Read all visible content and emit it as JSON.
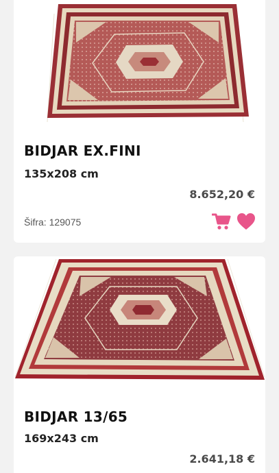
{
  "colors": {
    "accent": "#e8558a",
    "background": "#f2f2f2",
    "card": "#ffffff",
    "title": "#111111",
    "price": "#4a4a4a"
  },
  "products": [
    {
      "title": "BIDJAR EX.FINI",
      "size": "135x208 cm",
      "price": "8.652,20 €",
      "sku_label": "Šifra: 129075",
      "cart_icon": "shopping-cart-icon",
      "wishlist_icon": "heart-icon"
    },
    {
      "title": "BIDJAR 13/65",
      "size": "169x243 cm",
      "price": "2.641,18 €"
    }
  ]
}
